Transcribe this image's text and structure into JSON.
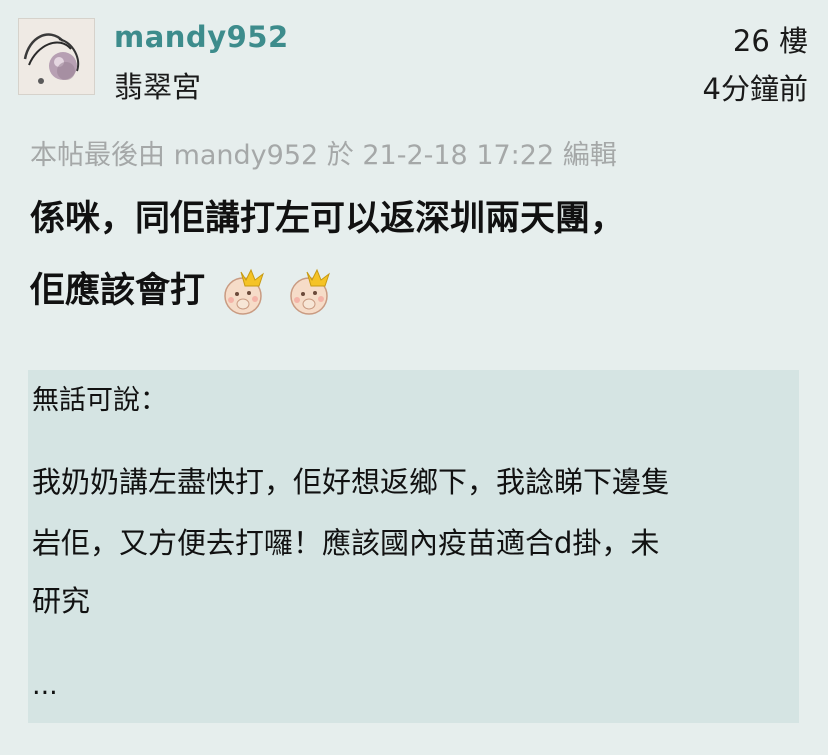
{
  "post": {
    "username": "mandy952",
    "group": "翡翠宮",
    "floor": "26 樓",
    "time": "4分鐘前",
    "edited_note": "本帖最後由 mandy952 於 21-2-18 17:22 編輯",
    "body_line1": "係咪，同佢講打左可以返深圳兩天團，",
    "body_line2": "佢應該會打",
    "emoji": [
      "baby-crown-emoji",
      "baby-crown-emoji"
    ]
  },
  "quote": {
    "author": "無話可說：",
    "lines": [
      "我奶奶講左盡快打，佢好想返鄉下，我諗睇下邊隻",
      "岩佢，又方便去打囉！應該國內疫苗適合d掛，未",
      "研究"
    ],
    "ellipsis": "..."
  },
  "colors": {
    "background": "#e6eeed",
    "username": "#3d8c8c",
    "quote_background": "#d5e4e3",
    "muted_text": "#a5a8a8"
  }
}
